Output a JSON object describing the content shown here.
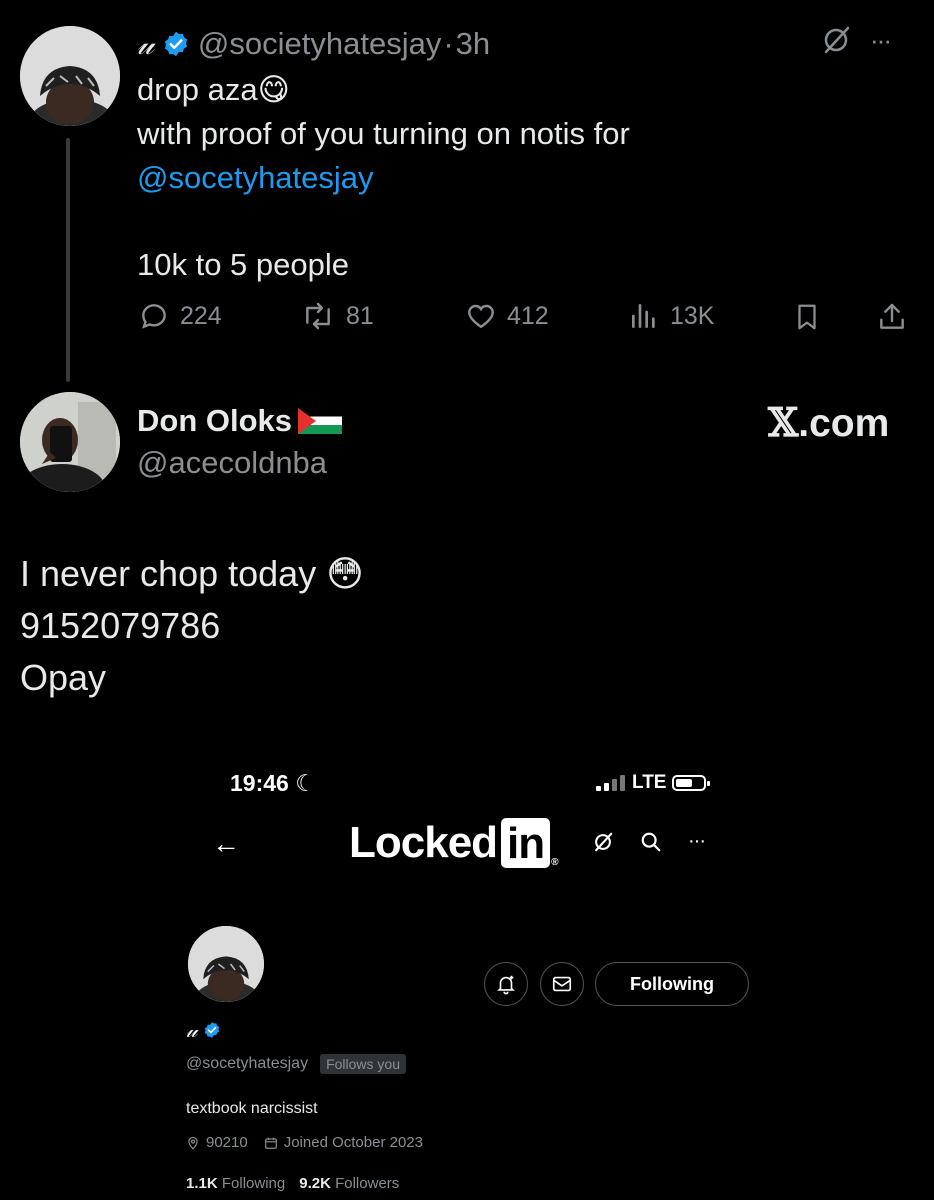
{
  "tweet1": {
    "display_name": "𝓊",
    "handle": "@societyhatesjay",
    "separator": "·",
    "time": "3h",
    "body_line1": "drop aza",
    "emoji1": "😋",
    "body_line2": "with proof of you turning on notis for",
    "mention": "@socetyhatesjay",
    "body_line3": "10k to 5 people",
    "replies": "224",
    "reposts": "81",
    "likes": "412",
    "views": "13K",
    "more": "···"
  },
  "tweet2": {
    "display_name": "Don Oloks",
    "flag": "🇵🇸",
    "handle": "@acecoldnba",
    "watermark_x": "𝕏",
    "watermark_rest": ".com",
    "body_line1": "I never chop today ",
    "emoji": "😳",
    "body_line2": "9152079786",
    "body_line3": "Opay"
  },
  "embedded": {
    "status_time": "19:46",
    "moon": "☾",
    "network": "LTE",
    "back_arrow": "←",
    "logo_text": "Locked",
    "logo_in": "in",
    "logo_reg": "®",
    "more": "···",
    "following_button": "Following",
    "profile_name": "𝓊",
    "profile_handle": "@socetyhatesjay",
    "follows_you": "Follows you",
    "bio": "textbook narcissist",
    "location": "90210",
    "joined": "Joined October 2023",
    "following_count": "1.1K",
    "following_label": "Following",
    "followers_count": "9.2K",
    "followers_label": "Followers"
  },
  "colors": {
    "link": "#1d9bf0",
    "verified": "#1d9bf0",
    "muted": "#8a8f94",
    "background": "#000000"
  },
  "icons": [
    "verified-badge-icon",
    "grok-icon",
    "more-icon",
    "reply-icon",
    "repost-icon",
    "like-icon",
    "views-icon",
    "bookmark-icon",
    "share-icon",
    "notification-bell-icon",
    "mail-icon",
    "search-icon",
    "location-icon",
    "calendar-icon"
  ]
}
